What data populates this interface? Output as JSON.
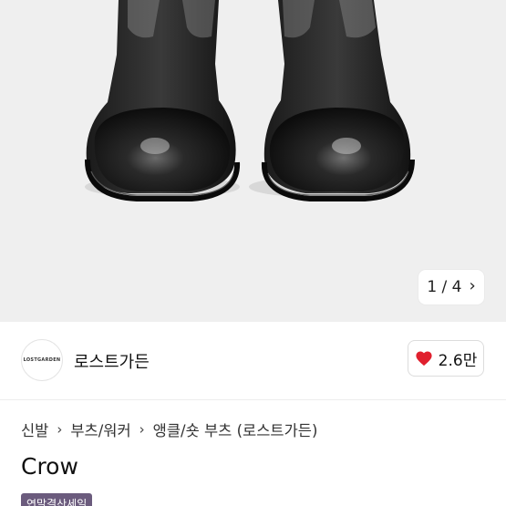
{
  "gallery": {
    "image_alt": "black chelsea boots",
    "pager_text": "1 / 4",
    "next_icon": "chevron-right-icon"
  },
  "store": {
    "logo_text": "LOSTGARDEN",
    "name": "로스트가든",
    "like_count": "2.6만",
    "like_icon": "heart-icon",
    "like_color": "#e0202e"
  },
  "breadcrumb": {
    "items": [
      "신발",
      "부츠/워커",
      "앵클/숏 부츠 (로스트가든)"
    ],
    "separator_icon": "chevron-right-icon"
  },
  "product": {
    "title": "Crow",
    "tag": "연말결산세일",
    "tag_color": "#6b5b7d"
  }
}
